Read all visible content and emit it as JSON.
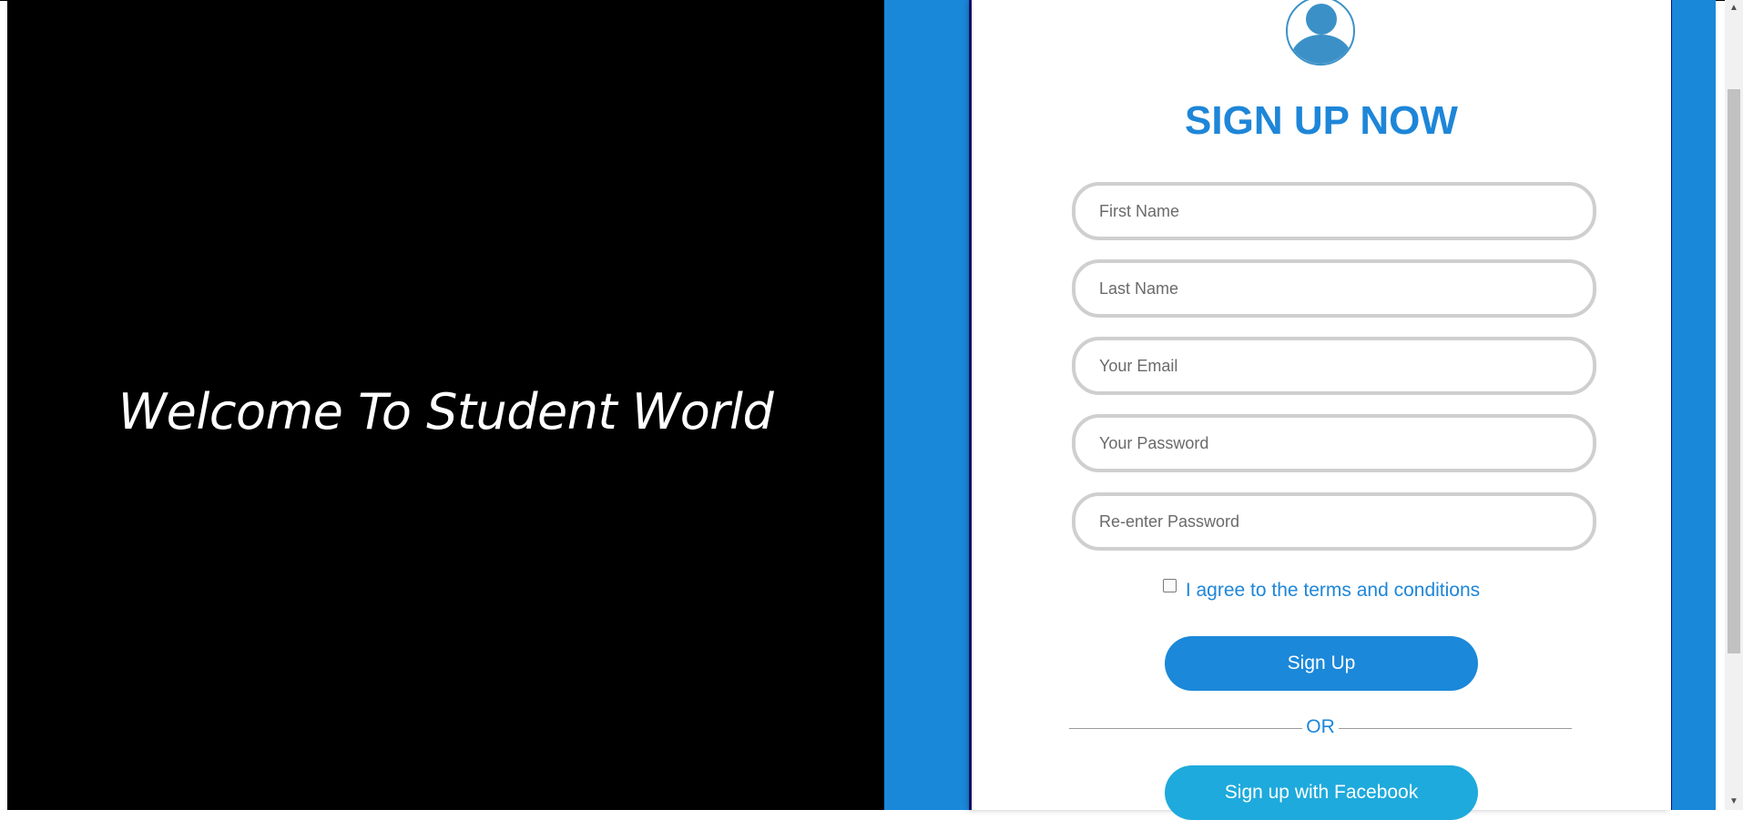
{
  "left": {
    "welcome_text": "Welcome To Student World"
  },
  "form": {
    "title": "SIGN UP NOW",
    "fields": {
      "first_name": "First Name",
      "last_name": "Last Name",
      "email": "Your Email",
      "password": "Your Password",
      "reenter_password": "Re-enter Password"
    },
    "terms_label": "I agree to the terms and conditions",
    "terms_checked": false,
    "signup_button": "Sign Up",
    "or_text": "OR",
    "facebook_button": "Sign up with Facebook"
  },
  "colors": {
    "accent": "#1e86d8",
    "band": "#1a88d9",
    "facebook_button": "#1eaadc",
    "left_panel": "#000000"
  },
  "icons": {
    "avatar": "user-avatar-icon",
    "scroll_up": "scroll-up-arrow-icon",
    "scroll_down": "scroll-down-arrow-icon"
  },
  "scrollbar": {
    "position": 0.12
  }
}
